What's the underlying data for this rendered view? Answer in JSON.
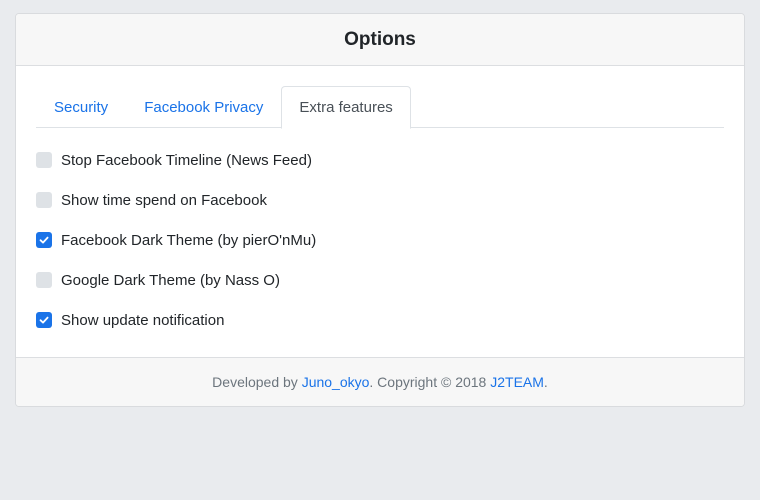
{
  "header": {
    "title": "Options"
  },
  "tabs": [
    {
      "label": "Security",
      "active": false
    },
    {
      "label": "Facebook Privacy",
      "active": false
    },
    {
      "label": "Extra features",
      "active": true
    }
  ],
  "options": [
    {
      "label": "Stop Facebook Timeline (News Feed)",
      "checked": false
    },
    {
      "label": "Show time spend on Facebook",
      "checked": false
    },
    {
      "label": "Facebook Dark Theme (by pierO'nMu)",
      "checked": true
    },
    {
      "label": "Google Dark Theme (by Nass O)",
      "checked": false
    },
    {
      "label": "Show update notification",
      "checked": true
    }
  ],
  "footer": {
    "prefix": "Developed by ",
    "author": "Juno_okyo",
    "middle": ". Copyright © 2018 ",
    "org": "J2TEAM",
    "suffix": "."
  },
  "colors": {
    "accent": "#1a73e8",
    "background": "#e9ebee",
    "checkbox_off": "#dee2e6"
  }
}
